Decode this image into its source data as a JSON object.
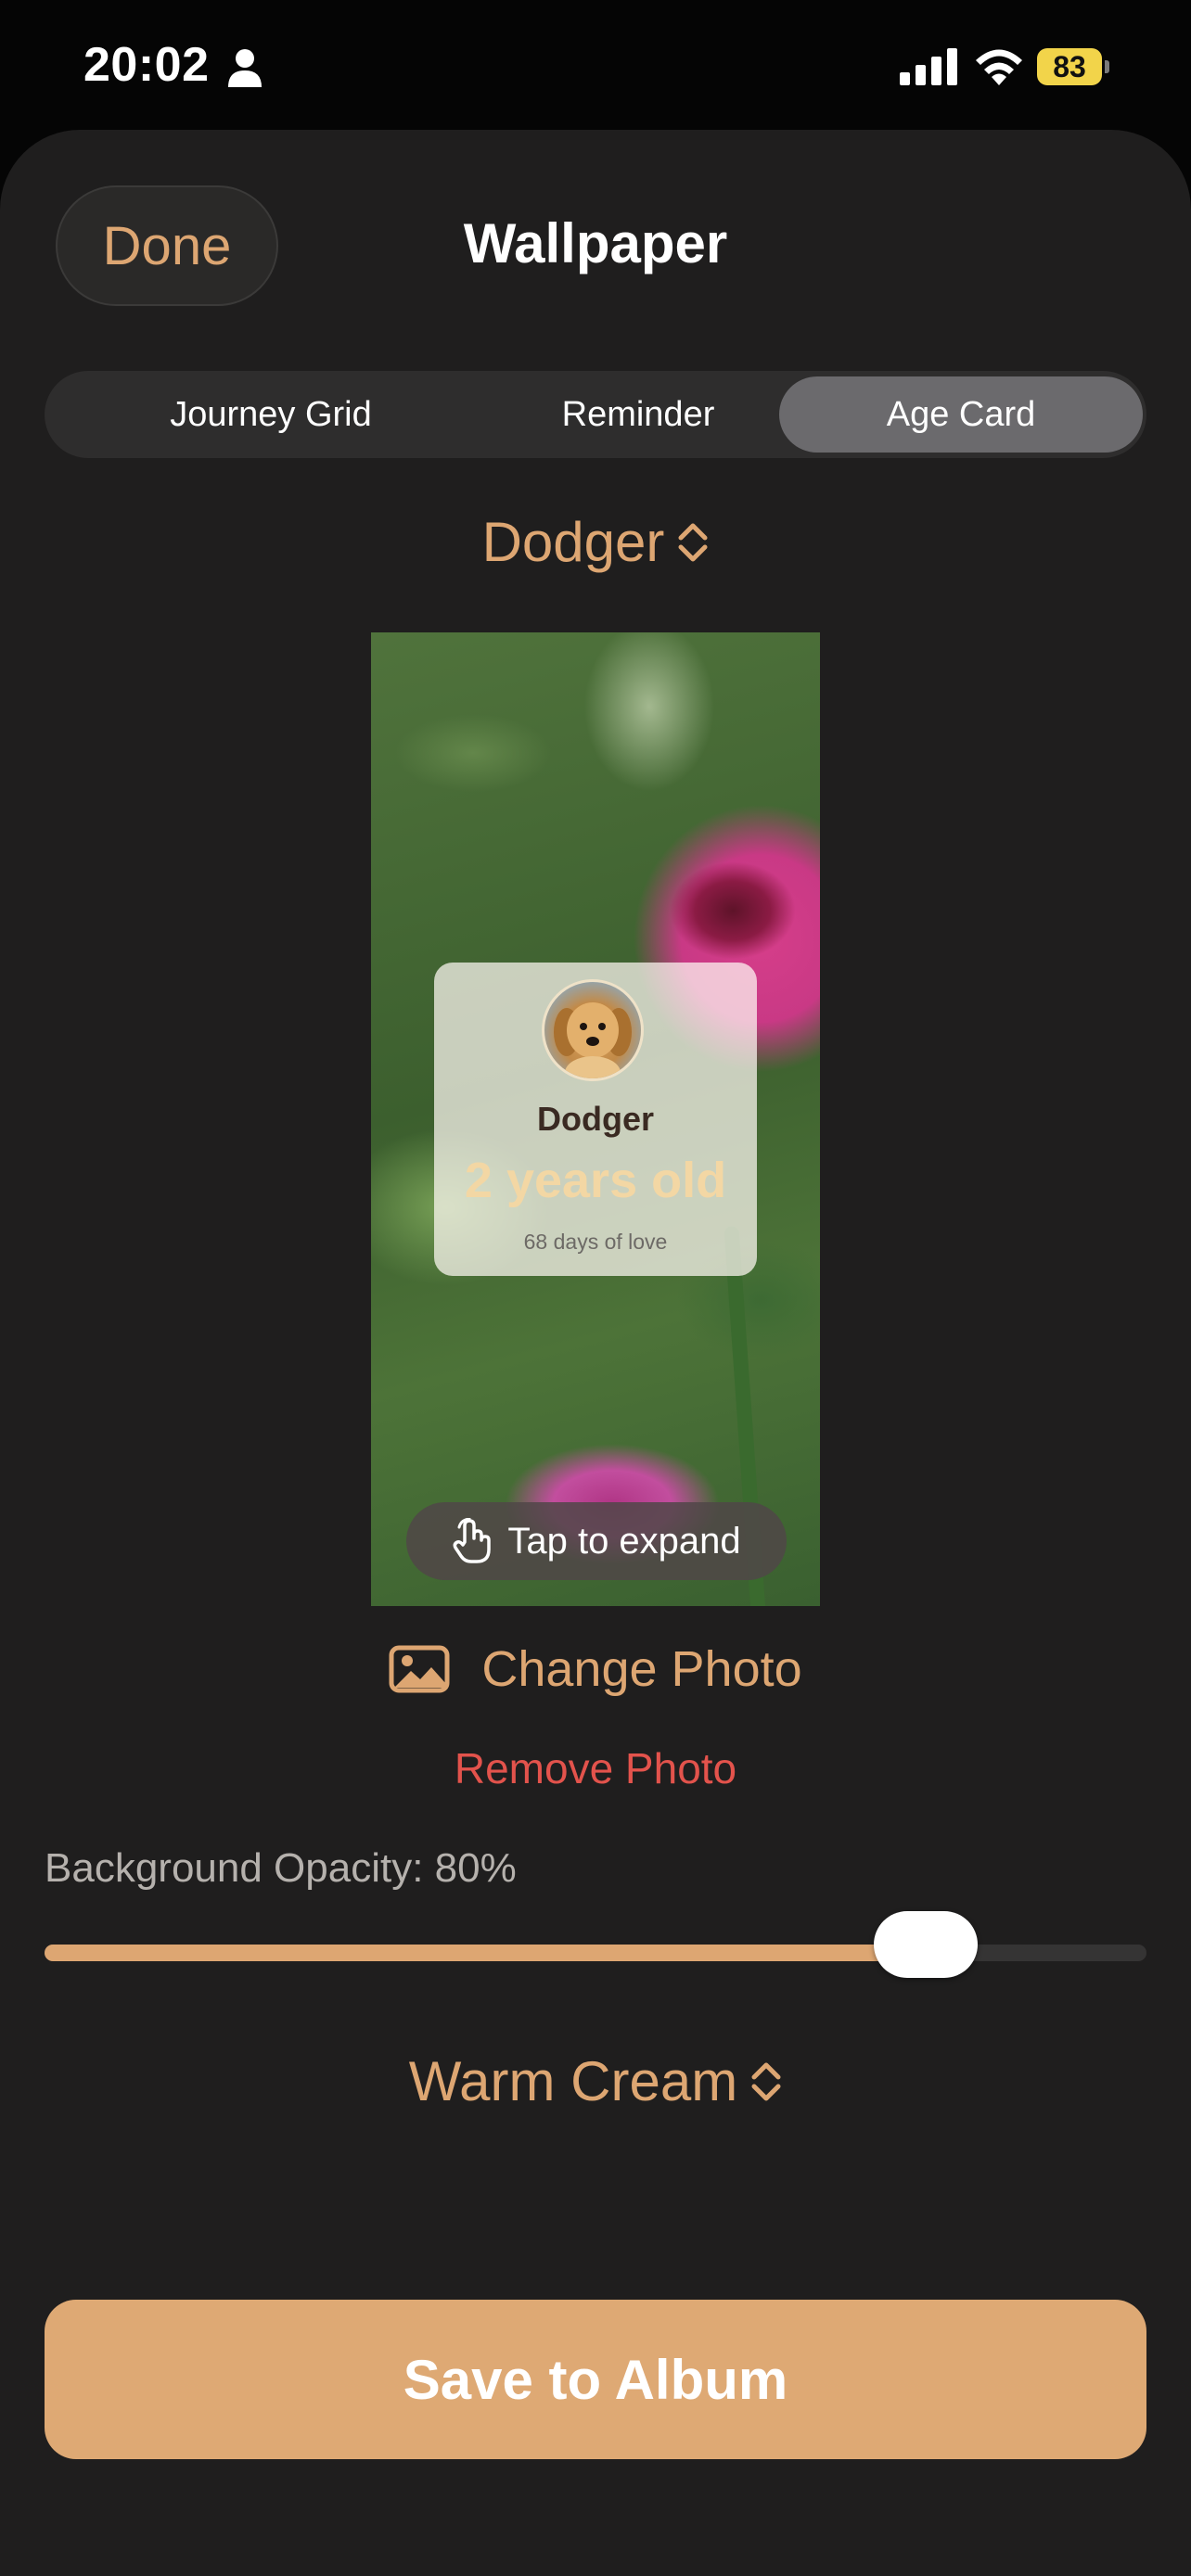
{
  "status_bar": {
    "time": "20:02",
    "battery": "83"
  },
  "header": {
    "done_label": "Done",
    "title": "Wallpaper"
  },
  "tabs": [
    {
      "label": "Journey Grid",
      "active": false
    },
    {
      "label": "Reminder",
      "active": false
    },
    {
      "label": "Age Card",
      "active": true
    }
  ],
  "pet_picker": {
    "value": "Dodger"
  },
  "preview": {
    "card": {
      "name": "Dodger",
      "age": "2 years old",
      "days": "68 days of love"
    },
    "expand_label": "Tap to expand"
  },
  "photo_actions": {
    "change_label": "Change Photo",
    "remove_label": "Remove Photo"
  },
  "opacity": {
    "label": "Background Opacity: 80%",
    "value_percent": 80
  },
  "theme_picker": {
    "value": "Warm Cream"
  },
  "save_label": "Save to Album",
  "colors": {
    "accent": "#dda672",
    "destructive": "#e3534c",
    "sheet_bg": "#1f1e1e"
  }
}
